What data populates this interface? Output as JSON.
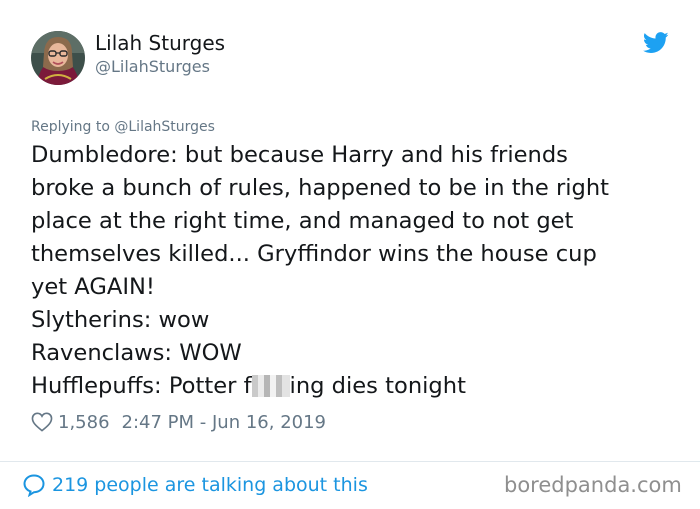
{
  "tweet": {
    "author_name": "Lilah Sturges",
    "author_handle": "@LilahSturges",
    "replying_to": "Replying to @LilahSturges",
    "lines": [
      "Dumbledore: but because Harry and his friends",
      "broke a bunch of rules, happened to be in the right",
      "place at the right time, and managed to not get",
      "themselves killed... Gryffindor wins the house cup",
      "yet AGAIN!",
      "Slytherins: wow",
      "Ravenclaws: WOW"
    ],
    "last_line_prefix": "Hufflepuffs: Potter f",
    "last_line_suffix": "ing dies tonight",
    "censored_word": "fucking",
    "likes": "1,586",
    "timestamp": "2:47 PM - Jun 16, 2019",
    "talking": "219 people are talking about this"
  },
  "watermark": "boredpanda.com",
  "icons": {
    "brand": "twitter-bird-icon",
    "like": "heart-icon",
    "reply": "speech-bubble-icon"
  },
  "colors": {
    "link": "#1b95e0",
    "muted": "#657786",
    "text": "#14171a"
  }
}
